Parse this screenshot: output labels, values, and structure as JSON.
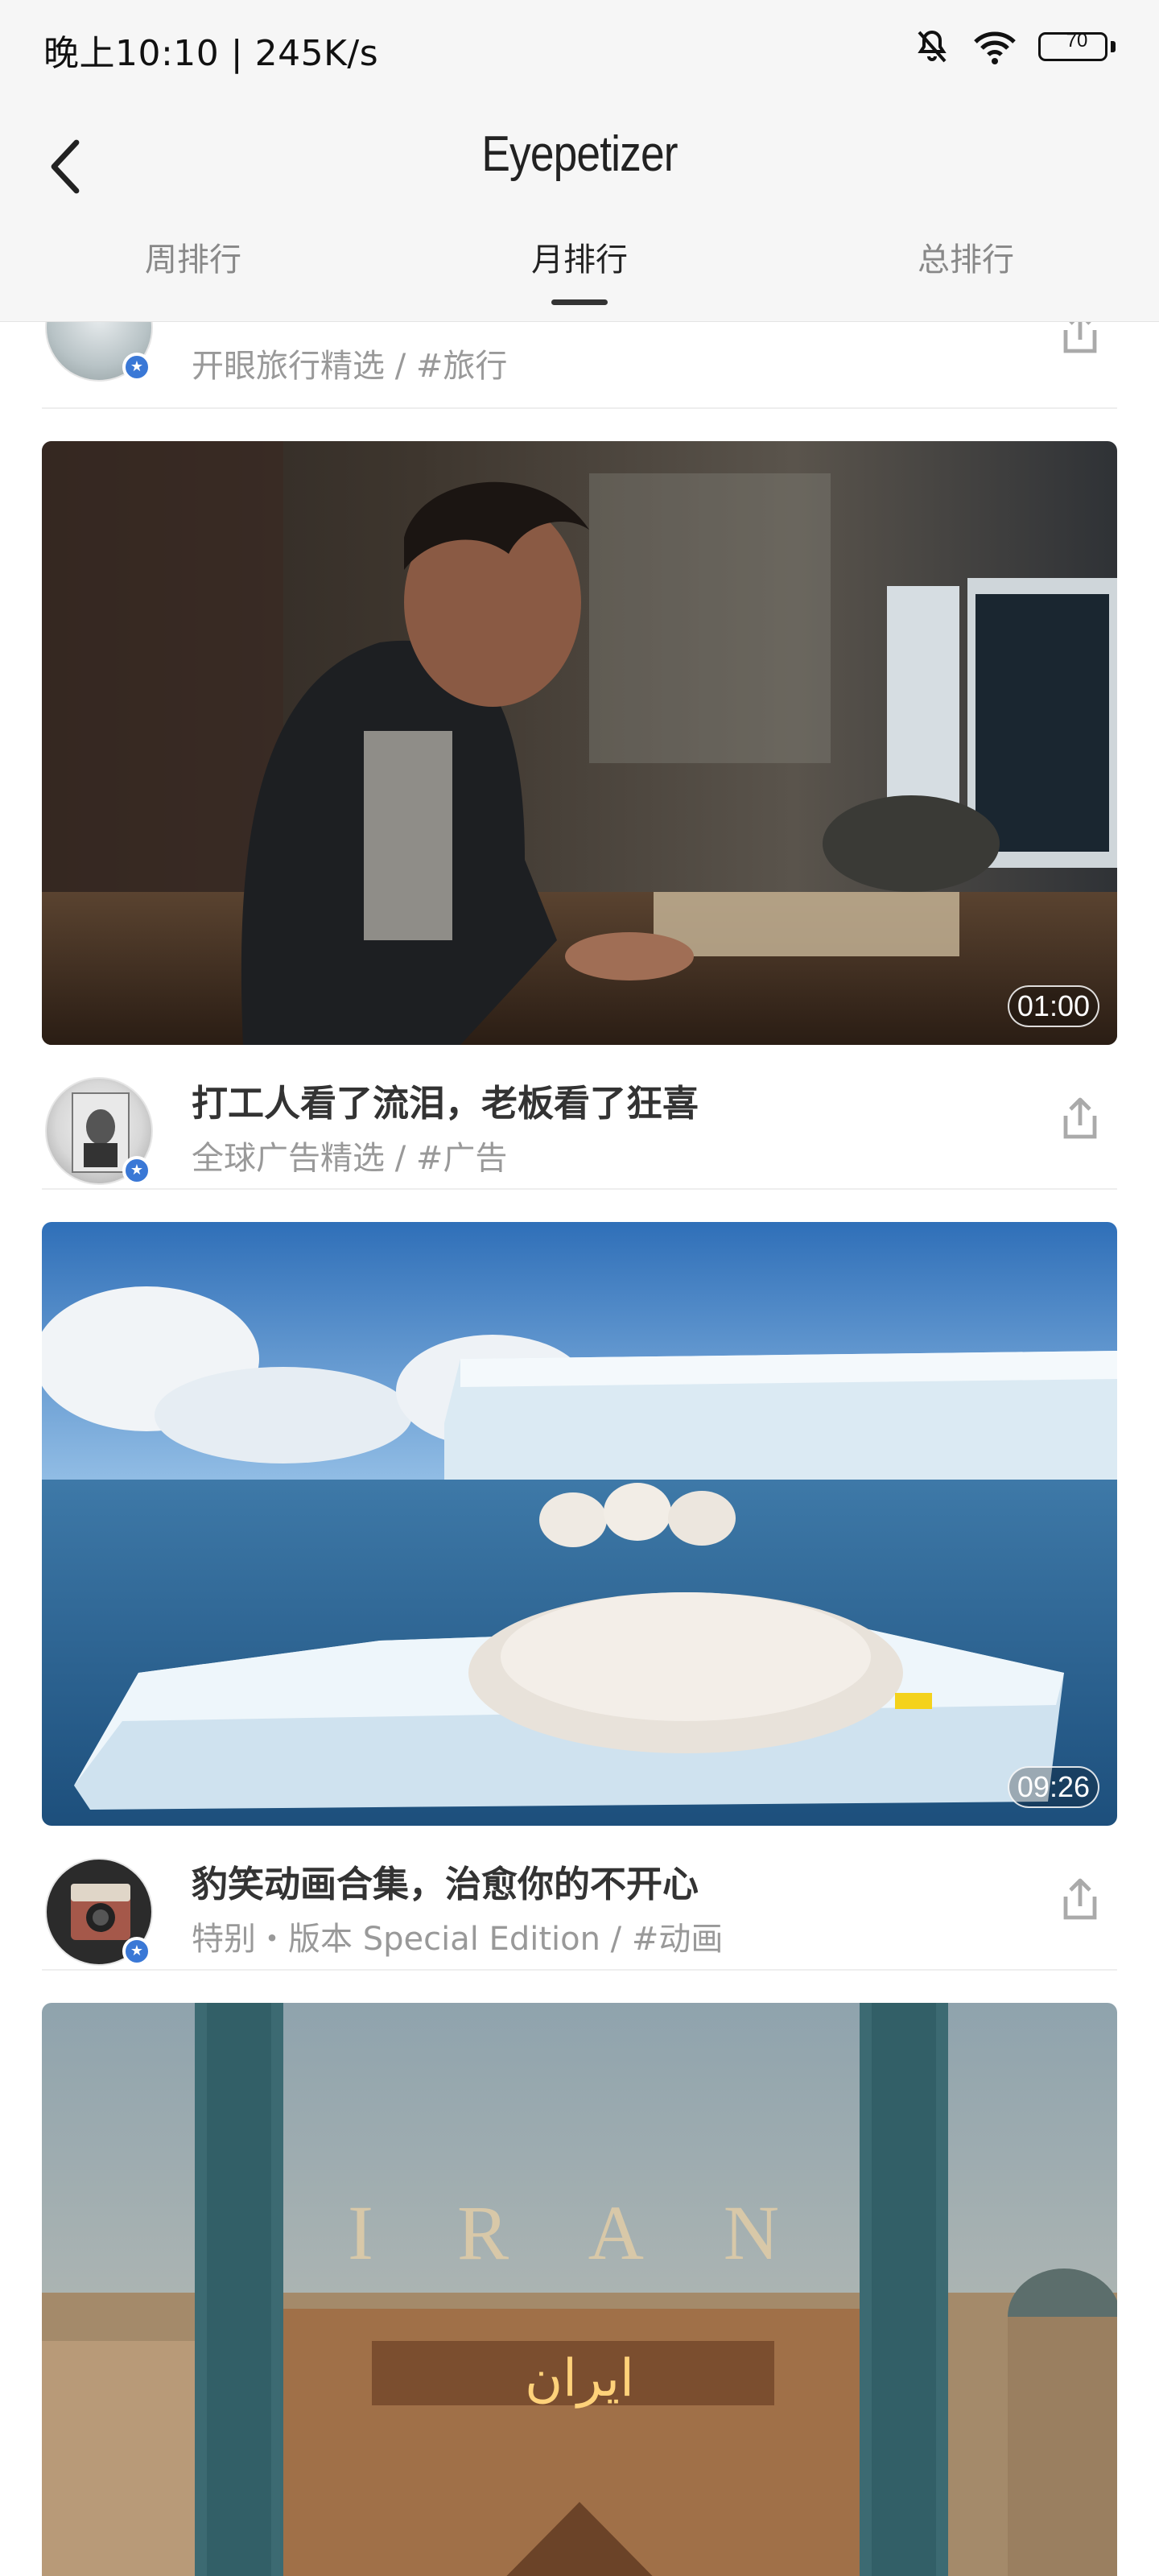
{
  "status_bar": {
    "time_speed": "晚上10:10 | 245K/s",
    "battery_level": "70"
  },
  "header": {
    "title": "Eyepetizer",
    "tabs": [
      {
        "label": "周排行",
        "active": false
      },
      {
        "label": "月排行",
        "active": true
      },
      {
        "label": "总排行",
        "active": false
      }
    ]
  },
  "feed": {
    "partial_item": {
      "subtitle": "开眼旅行精选  /  #旅行"
    },
    "items": [
      {
        "duration": "01:00",
        "title": "打工人看了流泪，老板看了狂喜",
        "subtitle": "全球广告精选  /  #广告"
      },
      {
        "duration": "09:26",
        "title": "豹笑动画合集，治愈你的不开心",
        "subtitle": "特别・版本 Special Edition  /  #动画"
      },
      {
        "image_text": "I R A N",
        "image_text_2": "ایران"
      }
    ]
  },
  "colors": {
    "header_bg": "#f6f6f6",
    "badge_blue": "#3a78d6",
    "text_primary": "#333333",
    "text_secondary": "#999999"
  }
}
